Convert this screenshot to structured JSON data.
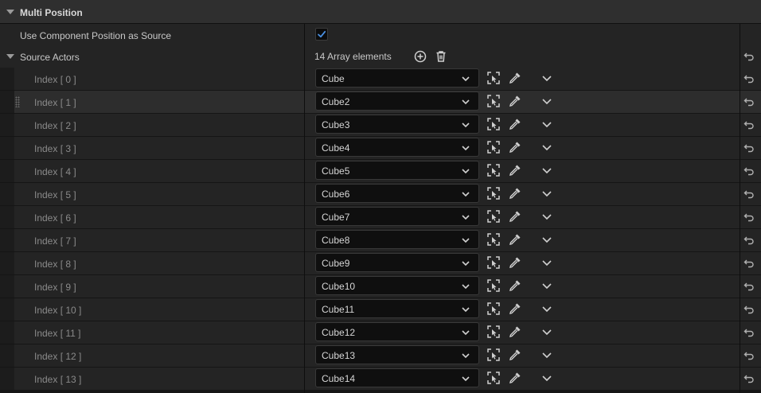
{
  "category": {
    "title": "Multi Position"
  },
  "use_component_position": {
    "label": "Use Component Position as Source",
    "checked": true
  },
  "source_actors": {
    "label": "Source Actors",
    "count_text": "14 Array elements",
    "elements": [
      {
        "index_label": "Index [ 0 ]",
        "value": "Cube"
      },
      {
        "index_label": "Index [ 1 ]",
        "value": "Cube2"
      },
      {
        "index_label": "Index [ 2 ]",
        "value": "Cube3"
      },
      {
        "index_label": "Index [ 3 ]",
        "value": "Cube4"
      },
      {
        "index_label": "Index [ 4 ]",
        "value": "Cube5"
      },
      {
        "index_label": "Index [ 5 ]",
        "value": "Cube6"
      },
      {
        "index_label": "Index [ 6 ]",
        "value": "Cube7"
      },
      {
        "index_label": "Index [ 7 ]",
        "value": "Cube8"
      },
      {
        "index_label": "Index [ 8 ]",
        "value": "Cube9"
      },
      {
        "index_label": "Index [ 9 ]",
        "value": "Cube10"
      },
      {
        "index_label": "Index [ 10 ]",
        "value": "Cube11"
      },
      {
        "index_label": "Index [ 11 ]",
        "value": "Cube12"
      },
      {
        "index_label": "Index [ 12 ]",
        "value": "Cube13"
      },
      {
        "index_label": "Index [ 13 ]",
        "value": "Cube14"
      }
    ]
  },
  "icons": {
    "collapse": "chevron-down-icon",
    "add": "add-circle-icon",
    "delete": "trash-icon",
    "browse": "select-actor-icon",
    "picker": "eyedropper-icon",
    "expand": "chevron-down-icon",
    "reset": "reset-arrow-icon"
  },
  "colors": {
    "accent": "#4a90e2",
    "background": "#242424",
    "header": "#2f2f2f"
  }
}
